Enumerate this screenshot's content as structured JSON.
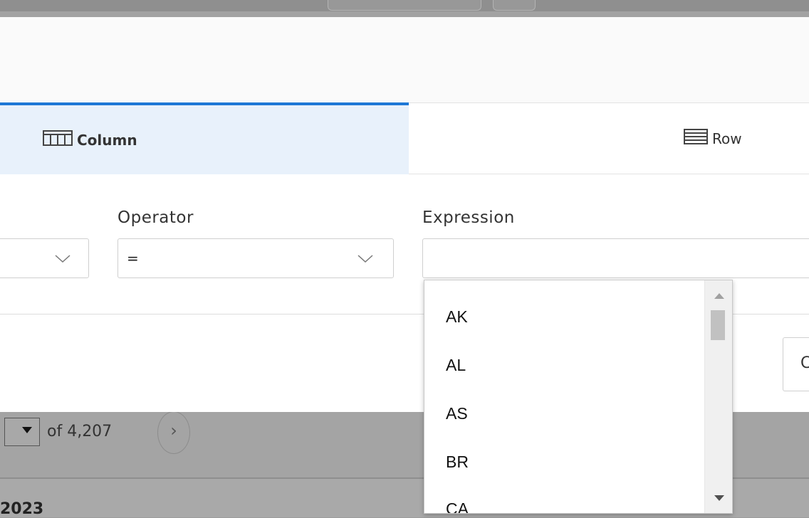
{
  "tabs": [
    {
      "label": "Column",
      "icon": "columns-icon",
      "active": true
    },
    {
      "label": "Row",
      "icon": "rows-icon",
      "active": false
    }
  ],
  "filter": {
    "operator_label": "Operator",
    "operator_value": "=",
    "expression_label": "Expression",
    "expression_value": ""
  },
  "dropdown": {
    "options": [
      "AK",
      "AL",
      "AS",
      "BR",
      "CA"
    ]
  },
  "footer": {
    "button_label": "C"
  },
  "background": {
    "page_of": "of 4,207",
    "next_glyph": "›",
    "year": "2023"
  },
  "colors": {
    "accent": "#1d77d6",
    "active_tab_bg": "#e8f1fb"
  }
}
